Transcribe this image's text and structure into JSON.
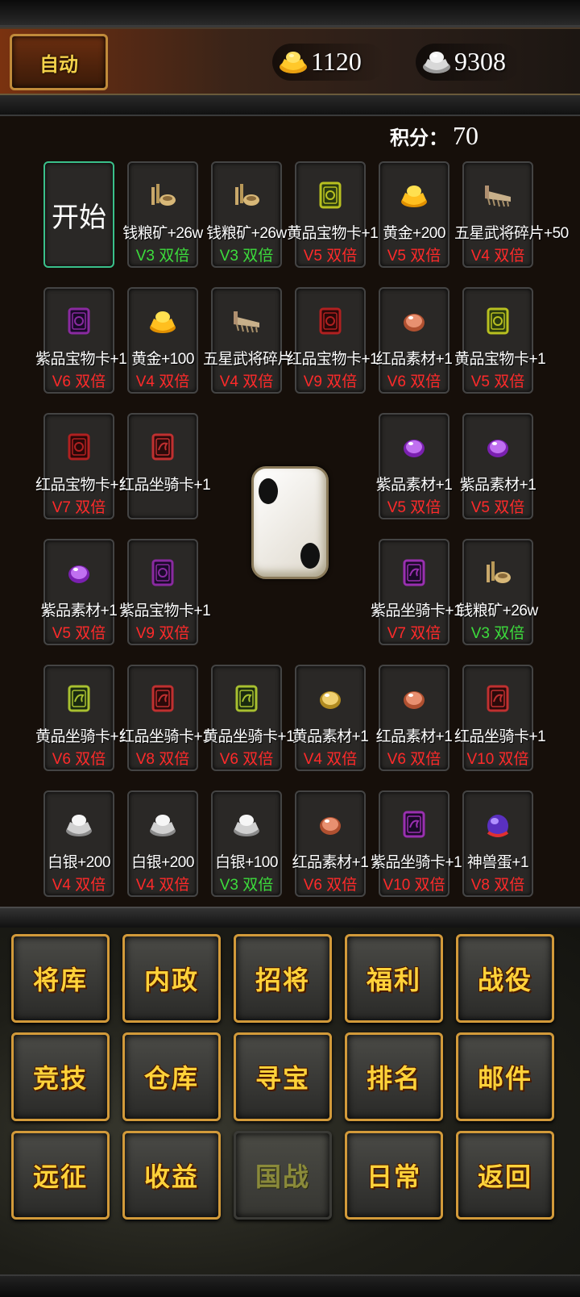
{
  "header": {
    "auto_label": "自动",
    "gold": "1120",
    "silver": "9308",
    "gold_icon": "gold-ingot-icon",
    "silver_icon": "silver-ingot-icon"
  },
  "score": {
    "label": "积分：",
    "value": "70"
  },
  "start_label": "开始",
  "dice_value": 2,
  "cells": [
    {
      "label": "钱粮矿+26w",
      "vip": "V3 双倍",
      "vip_color": "green",
      "icon": "grain-ore-icon"
    },
    {
      "label": "钱粮矿+26w",
      "vip": "V3 双倍",
      "vip_color": "green",
      "icon": "grain-ore-icon"
    },
    {
      "label": "黄品宝物卡+1",
      "vip": "V5 双倍",
      "vip_color": "red",
      "icon": "yellow-treasure-card-icon"
    },
    {
      "label": "黄金+200",
      "vip": "V5 双倍",
      "vip_color": "red",
      "icon": "gold-ingot-icon"
    },
    {
      "label": "五星武将碎片+50",
      "vip": "V4 双倍",
      "vip_color": "red",
      "icon": "general-fragment-icon"
    },
    {
      "label": "紫品宝物卡+1",
      "vip": "V6 双倍",
      "vip_color": "red",
      "icon": "purple-treasure-card-icon"
    },
    {
      "label": "黄金+100",
      "vip": "V4 双倍",
      "vip_color": "red",
      "icon": "gold-ingot-icon"
    },
    {
      "label": "五星武将碎片+50",
      "vip": "V4 双倍",
      "vip_color": "red",
      "icon": "general-fragment-icon"
    },
    {
      "label": "红品宝物卡+1",
      "vip": "V9 双倍",
      "vip_color": "red",
      "icon": "red-treasure-card-icon"
    },
    {
      "label": "红品素材+1",
      "vip": "V6 双倍",
      "vip_color": "red",
      "icon": "red-material-icon"
    },
    {
      "label": "黄品宝物卡+1",
      "vip": "V5 双倍",
      "vip_color": "red",
      "icon": "yellow-treasure-card-icon"
    },
    {
      "label": "红品宝物卡+1",
      "vip": "V7 双倍",
      "vip_color": "red",
      "icon": "red-treasure-card-icon"
    },
    {
      "label": "红品坐骑卡+1",
      "vip": "",
      "vip_color": "red",
      "icon": "red-mount-card-icon"
    },
    {
      "label": "紫品素材+1",
      "vip": "V5 双倍",
      "vip_color": "red",
      "icon": "purple-material-icon"
    },
    {
      "label": "紫品素材+1",
      "vip": "V5 双倍",
      "vip_color": "red",
      "icon": "purple-material-icon"
    },
    {
      "label": "紫品素材+1",
      "vip": "V5 双倍",
      "vip_color": "red",
      "icon": "purple-material-icon"
    },
    {
      "label": "紫品宝物卡+1",
      "vip": "V9 双倍",
      "vip_color": "red",
      "icon": "purple-treasure-card-icon"
    },
    {
      "label": "紫品坐骑卡+1",
      "vip": "V7 双倍",
      "vip_color": "red",
      "icon": "purple-mount-card-icon"
    },
    {
      "label": "钱粮矿+26w",
      "vip": "V3 双倍",
      "vip_color": "green",
      "icon": "grain-ore-icon"
    },
    {
      "label": "黄品坐骑卡+1",
      "vip": "V6 双倍",
      "vip_color": "red",
      "icon": "yellow-mount-card-icon"
    },
    {
      "label": "红品坐骑卡+1",
      "vip": "V8 双倍",
      "vip_color": "red",
      "icon": "red-mount-card-icon"
    },
    {
      "label": "黄品坐骑卡+1",
      "vip": "V6 双倍",
      "vip_color": "red",
      "icon": "yellow-mount-card-icon"
    },
    {
      "label": "黄品素材+1",
      "vip": "V4 双倍",
      "vip_color": "red",
      "icon": "yellow-material-icon"
    },
    {
      "label": "红品素材+1",
      "vip": "V6 双倍",
      "vip_color": "red",
      "icon": "red-material-icon"
    },
    {
      "label": "红品坐骑卡+1",
      "vip": "V10 双倍",
      "vip_color": "red",
      "icon": "red-mount-card-icon"
    },
    {
      "label": "白银+200",
      "vip": "V4 双倍",
      "vip_color": "red",
      "icon": "silver-ingot-icon"
    },
    {
      "label": "白银+200",
      "vip": "V4 双倍",
      "vip_color": "red",
      "icon": "silver-ingot-icon"
    },
    {
      "label": "白银+100",
      "vip": "V3 双倍",
      "vip_color": "green",
      "icon": "silver-ingot-icon"
    },
    {
      "label": "红品素材+1",
      "vip": "V6 双倍",
      "vip_color": "red",
      "icon": "red-material-icon"
    },
    {
      "label": "紫品坐骑卡+1",
      "vip": "V10 双倍",
      "vip_color": "red",
      "icon": "purple-mount-card-icon"
    },
    {
      "label": "神兽蛋+1",
      "vip": "V8 双倍",
      "vip_color": "red",
      "icon": "beast-egg-icon"
    }
  ],
  "menu": [
    {
      "label": "将库",
      "name": "generals"
    },
    {
      "label": "内政",
      "name": "domestic"
    },
    {
      "label": "招将",
      "name": "recruit"
    },
    {
      "label": "福利",
      "name": "welfare"
    },
    {
      "label": "战役",
      "name": "campaign"
    },
    {
      "label": "竞技",
      "name": "arena"
    },
    {
      "label": "仓库",
      "name": "warehouse"
    },
    {
      "label": "寻宝",
      "name": "treasure-hunt"
    },
    {
      "label": "排名",
      "name": "ranking"
    },
    {
      "label": "邮件",
      "name": "mail"
    },
    {
      "label": "远征",
      "name": "expedition"
    },
    {
      "label": "收益",
      "name": "income"
    },
    {
      "label": "国战",
      "name": "nation-war",
      "disabled": true
    },
    {
      "label": "日常",
      "name": "daily"
    },
    {
      "label": "返回",
      "name": "back"
    }
  ],
  "colors": {
    "vip_red": "#ff2a2a",
    "vip_green": "#3cdc3c",
    "menu_text": "#ffd23a",
    "menu_border": "#d29a3a",
    "start_border": "#3ac08a"
  }
}
